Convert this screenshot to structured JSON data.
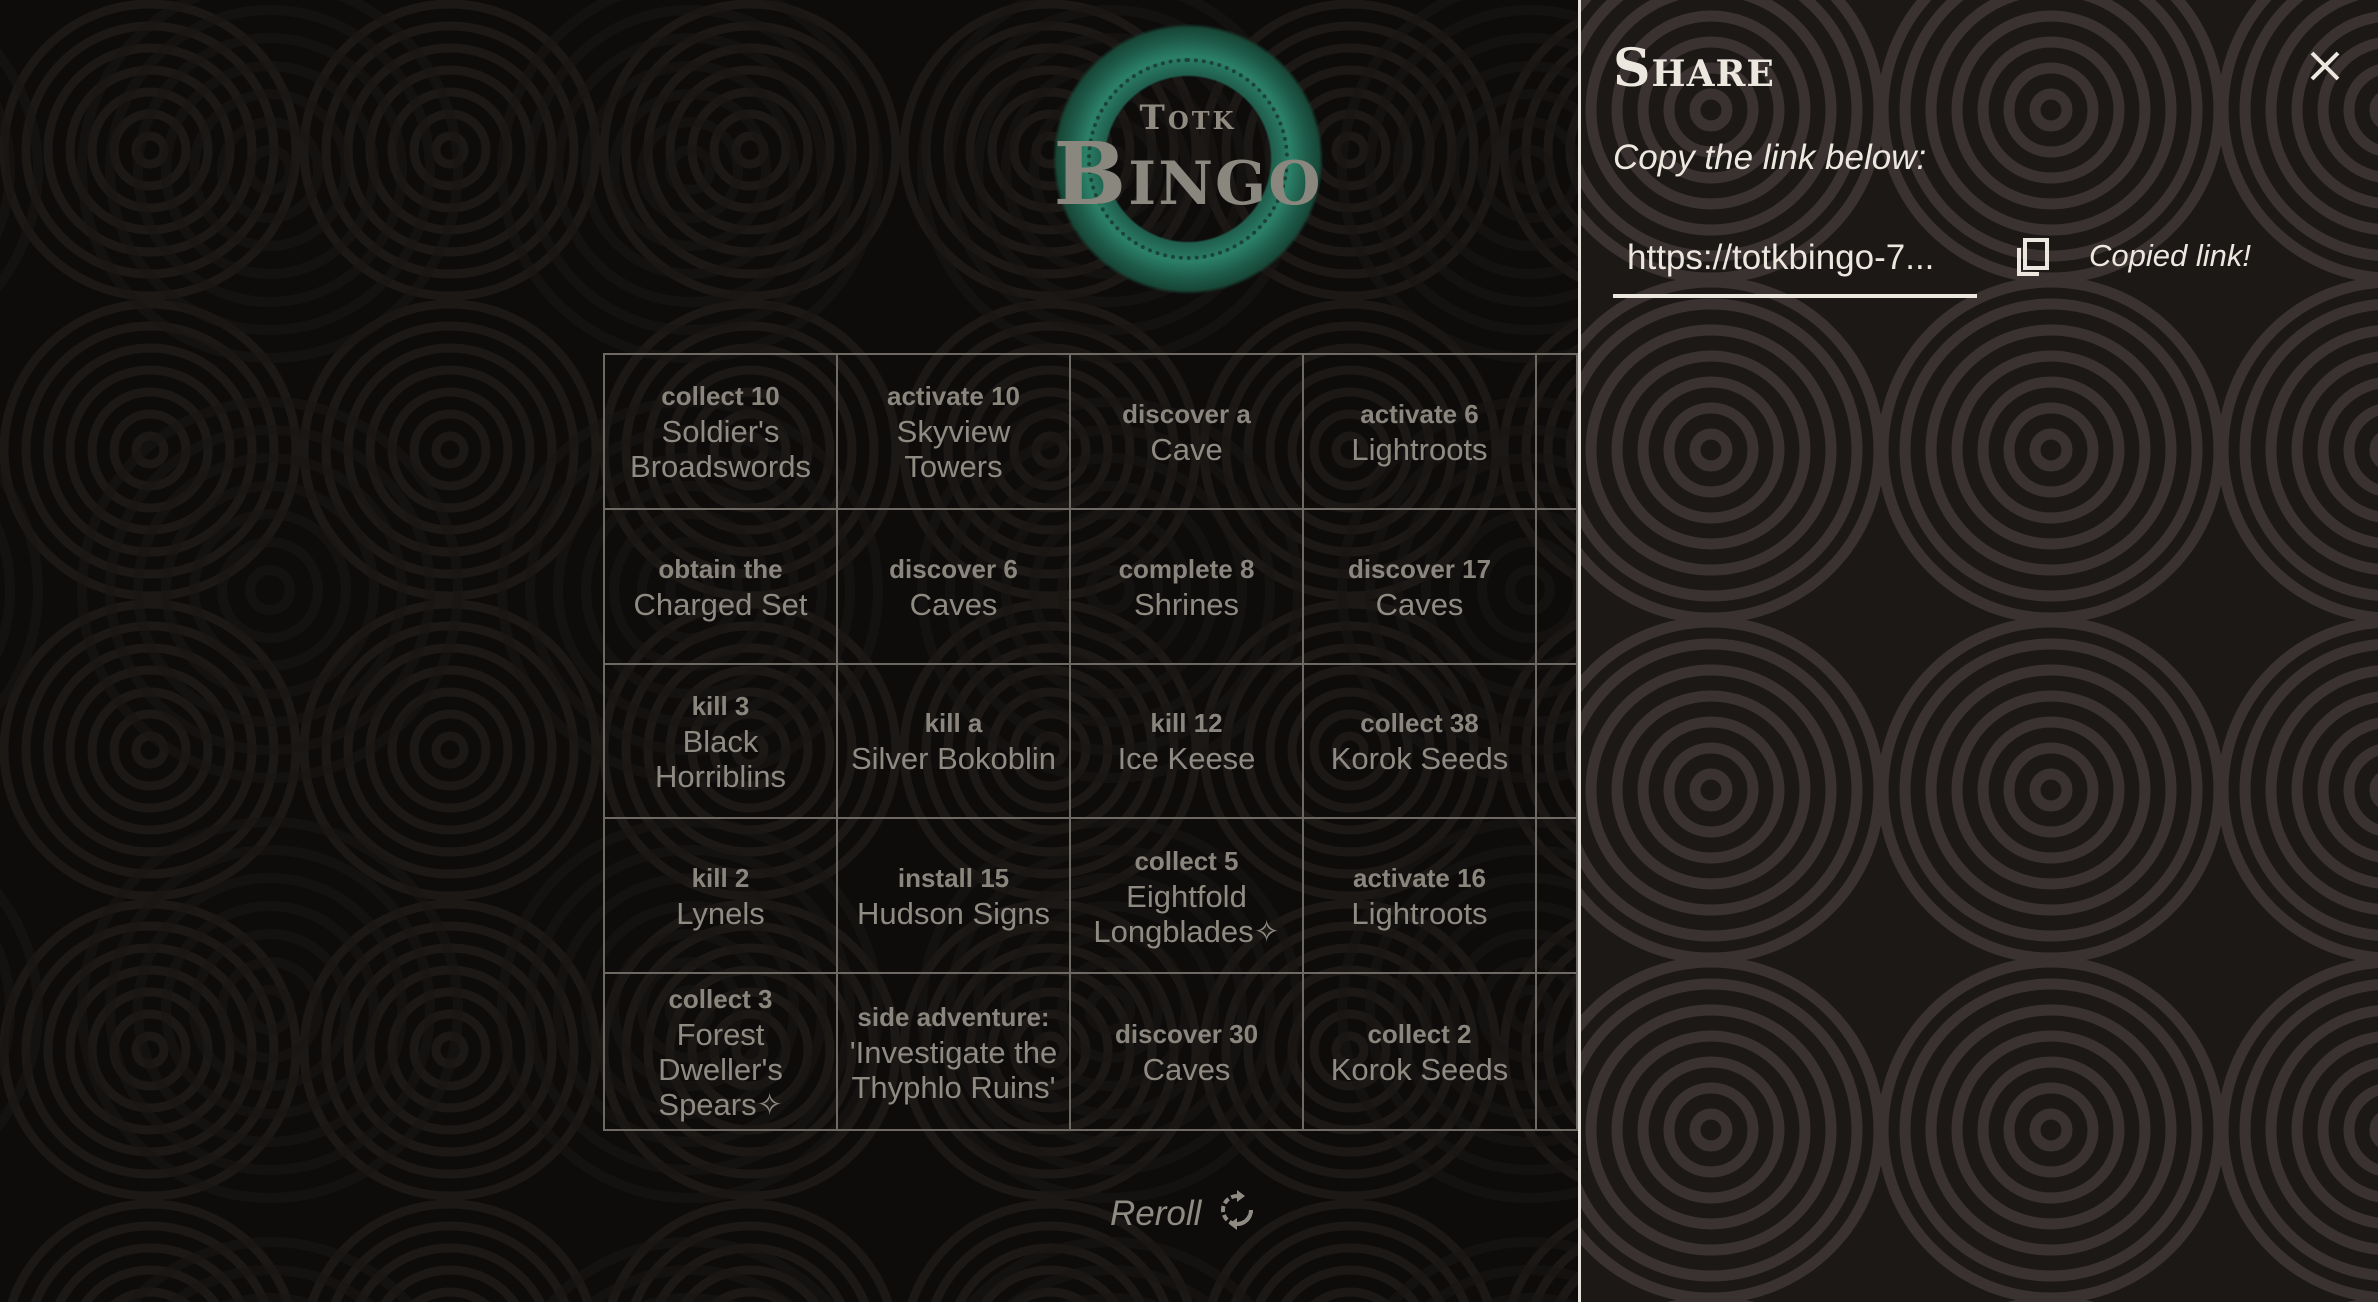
{
  "logo": {
    "small_text": "Totk",
    "big_text": "Bingo"
  },
  "grid": {
    "rows": [
      [
        {
          "verb": "collect 10",
          "object": "Soldier's Broadswords"
        },
        {
          "verb": "activate 10",
          "object": "Skyview Towers"
        },
        {
          "verb": "discover a",
          "object": "Cave"
        },
        {
          "verb": "activate 6",
          "object": "Lightroots"
        },
        {
          "verb": "",
          "object": ""
        }
      ],
      [
        {
          "verb": "obtain the",
          "object": "Charged Set"
        },
        {
          "verb": "discover 6",
          "object": "Caves"
        },
        {
          "verb": "complete 8",
          "object": "Shrines"
        },
        {
          "verb": "discover 17",
          "object": "Caves"
        },
        {
          "verb": "",
          "object": ""
        }
      ],
      [
        {
          "verb": "kill 3",
          "object": "Black Horriblins"
        },
        {
          "verb": "kill a",
          "object": "Silver Bokoblin"
        },
        {
          "verb": "kill 12",
          "object": "Ice Keese"
        },
        {
          "verb": "collect 38",
          "object": "Korok Seeds"
        },
        {
          "verb": "",
          "object": ""
        }
      ],
      [
        {
          "verb": "kill 2",
          "object": "Lynels"
        },
        {
          "verb": "install 15",
          "object": "Hudson Signs"
        },
        {
          "verb": "collect 5",
          "object": "Eightfold Longblades✧"
        },
        {
          "verb": "activate 16",
          "object": "Lightroots"
        },
        {
          "verb": "",
          "object": ""
        }
      ],
      [
        {
          "verb": "collect 3",
          "object": "Forest Dweller's Spears✧"
        },
        {
          "verb": "side adventure:",
          "object": "'Investigate the Thyphlo Ruins'"
        },
        {
          "verb": "discover 30",
          "object": "Caves"
        },
        {
          "verb": "collect 2",
          "object": "Korok Seeds"
        },
        {
          "verb": "",
          "object": ""
        }
      ]
    ]
  },
  "reroll": {
    "label": "Reroll",
    "icon": "refresh-icon"
  },
  "share_panel": {
    "title": "Share",
    "subtitle": "Copy the link below:",
    "link_value": "https://totkbingo-7...",
    "copied_text": "Copied link!",
    "close_icon": "close-icon",
    "copy_icon": "copy-icon"
  },
  "colors": {
    "panel_text": "#ece8df",
    "muted_text": "#8c887f",
    "logo_green": "#2b8067"
  }
}
